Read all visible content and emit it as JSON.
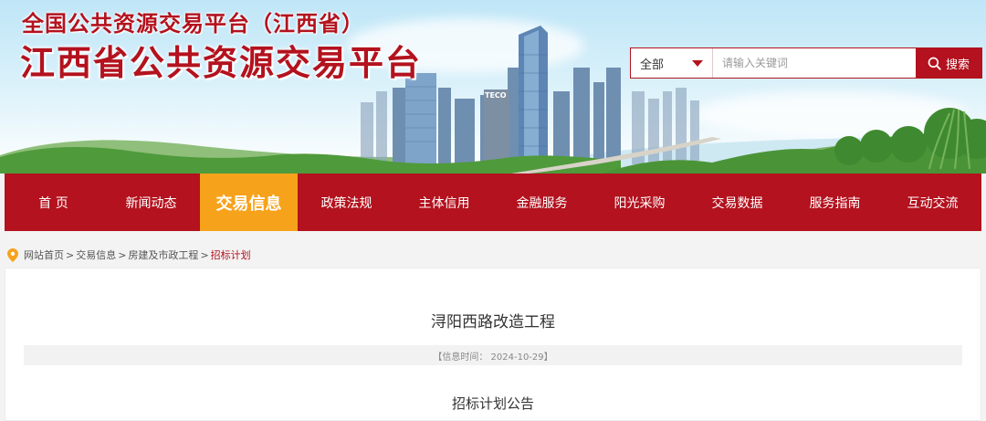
{
  "header": {
    "supertitle": "全国公共资源交易平台（江西省）",
    "title": "江西省公共资源交易平台"
  },
  "search": {
    "scope_value": "全部",
    "placeholder": "请输入关键词",
    "button_label": "搜索"
  },
  "nav": {
    "items": [
      {
        "label": "首 页"
      },
      {
        "label": "新闻动态"
      },
      {
        "label": "交易信息",
        "active": true
      },
      {
        "label": "政策法规"
      },
      {
        "label": "主体信用"
      },
      {
        "label": "金融服务"
      },
      {
        "label": "阳光采购"
      },
      {
        "label": "交易数据"
      },
      {
        "label": "服务指南"
      },
      {
        "label": "互动交流"
      }
    ]
  },
  "breadcrumb": {
    "items": [
      "网站首页",
      "交易信息",
      "房建及市政工程"
    ],
    "separator": ">",
    "current": "招标计划"
  },
  "article": {
    "title": "浔阳西路改造工程",
    "meta": "【信息时间： 2024-10-29】",
    "subtitle": "招标计划公告"
  },
  "colors": {
    "brand_red": "#b3121e",
    "accent_orange": "#f7a21b",
    "page_bg": "#f3f3f3"
  }
}
